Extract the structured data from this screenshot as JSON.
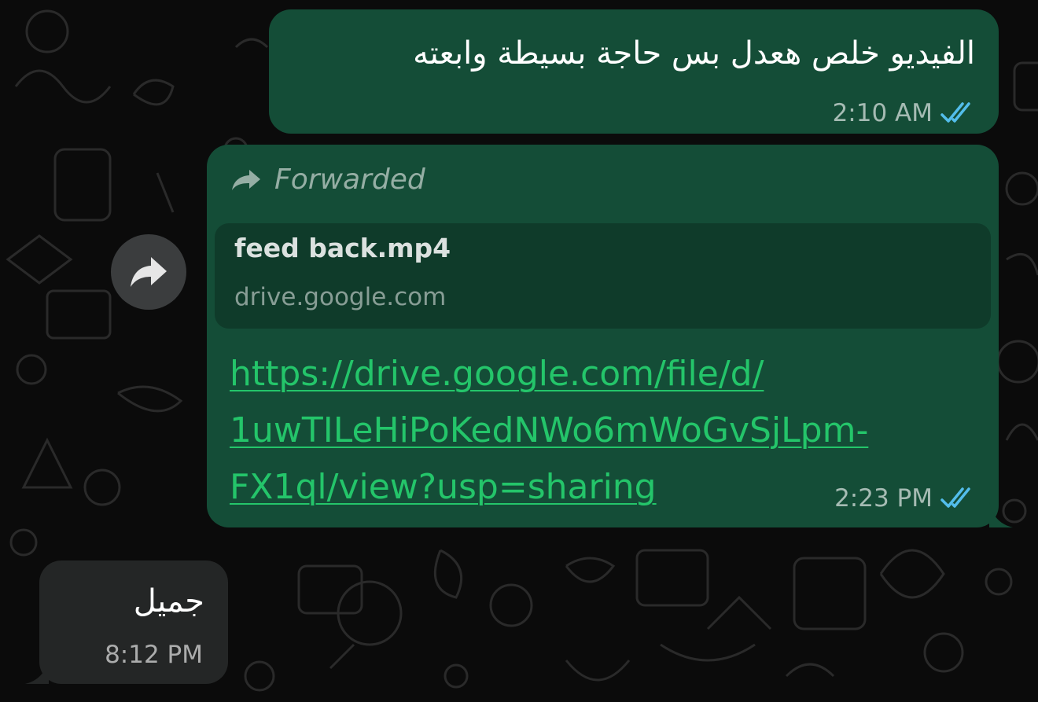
{
  "messages": [
    {
      "direction": "outgoing",
      "text": "الفيديو خلص هعدل بس حاجة بسيطة وابعته",
      "time": "2:10 AM",
      "status": "read"
    },
    {
      "direction": "outgoing",
      "forwarded_label": "Forwarded",
      "link_preview": {
        "title": "feed back.mp4",
        "domain": "drive.google.com"
      },
      "link_lines": [
        "https://drive.google.com/file/d/",
        "1uwTILeHiPoKedNWo6mWoGvSjLpm-",
        "FX1ql/view?usp=sharing"
      ],
      "time": "2:23 PM",
      "status": "read"
    },
    {
      "direction": "incoming",
      "text": "جميل",
      "time": "8:12 PM"
    }
  ],
  "icons": {
    "read_receipt": "double-check-icon",
    "forwarded": "forward-arrow-icon",
    "forward_button": "share-forward-icon"
  },
  "colors": {
    "outgoing_bubble": "#144d37",
    "incoming_bubble": "#242626",
    "link": "#24c56a",
    "read_check": "#53bdeb",
    "background": "#0b0b0b"
  }
}
